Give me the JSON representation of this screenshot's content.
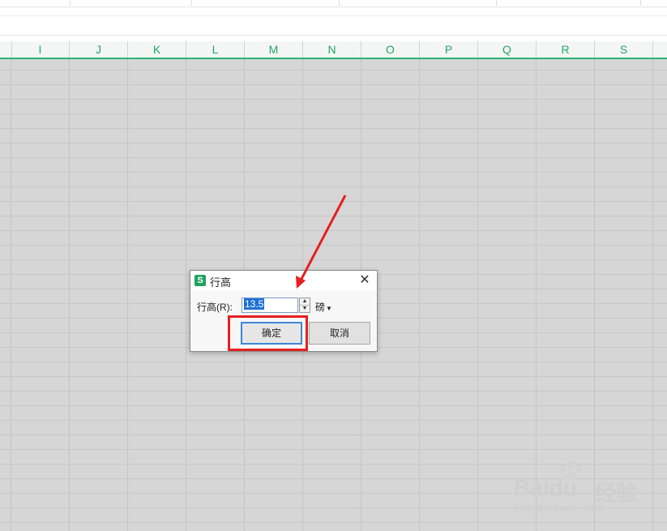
{
  "spreadsheet": {
    "columns": [
      "I",
      "J",
      "K",
      "L",
      "M",
      "N",
      "O",
      "P",
      "Q",
      "R",
      "S"
    ]
  },
  "dialog": {
    "title": "行高",
    "app_icon_glyph": "S",
    "close_glyph": "✕",
    "field_label": "行高(R):",
    "value": "13.5",
    "unit": "磅",
    "ok_label": "确定",
    "cancel_label": "取消"
  },
  "watermark": {
    "logo": "Baidu",
    "jingyan": "经验",
    "url": "jingyan.baidu.com"
  },
  "colors": {
    "accent": "#2bb673",
    "annotation": "#e52020",
    "selection": "#1e70d6"
  },
  "icons": {
    "app": "wps-spreadsheet-icon",
    "close": "close-icon",
    "spin_up": "spin-up-icon",
    "spin_down": "spin-down-icon",
    "unit_dropdown": "caret-down-icon"
  }
}
